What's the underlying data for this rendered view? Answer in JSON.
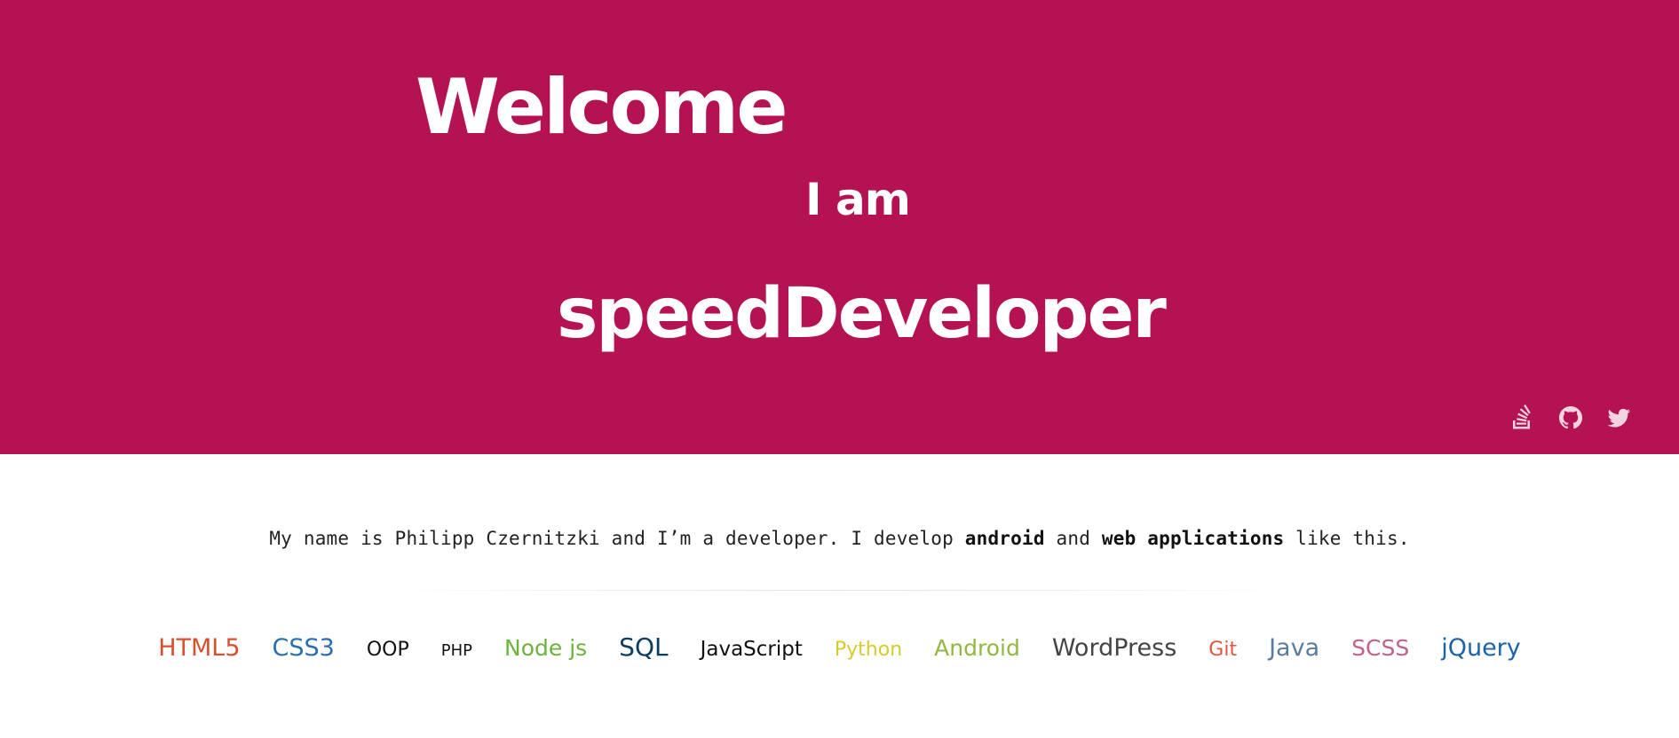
{
  "hero": {
    "title": "Welcome",
    "subtitle": "I am",
    "role": "speedDeveloper"
  },
  "social": [
    {
      "name": "stackoverflow",
      "icon": "stackoverflow-icon"
    },
    {
      "name": "github",
      "icon": "github-icon"
    },
    {
      "name": "twitter",
      "icon": "twitter-icon"
    }
  ],
  "intro": {
    "part1": "My name is Philipp Czernitzki and I’m a developer. I develop ",
    "bold1": "android",
    "part2": " and ",
    "bold2": "web applications",
    "part3": " like this."
  },
  "skills": [
    {
      "label": "HTML5",
      "color": "#d9502f"
    },
    {
      "label": "CSS3",
      "color": "#2b6fb3"
    },
    {
      "label": "OOP",
      "color": "#111111"
    },
    {
      "label": "PHP",
      "color": "#111111"
    },
    {
      "label": "Node js",
      "color": "#6cb33e"
    },
    {
      "label": "SQL",
      "color": "#0f3d61"
    },
    {
      "label": "JavaScript",
      "color": "#111111"
    },
    {
      "label": "Python",
      "color": "#d4cc2a"
    },
    {
      "label": "Android",
      "color": "#92b83f"
    },
    {
      "label": "WordPress",
      "color": "#444444"
    },
    {
      "label": "Git",
      "color": "#e2543b"
    },
    {
      "label": "Java",
      "color": "#5a7d9e"
    },
    {
      "label": "SCSS",
      "color": "#c4608e"
    },
    {
      "label": "jQuery",
      "color": "#1b64a8"
    }
  ],
  "colors": {
    "hero_bg": "#b51253"
  }
}
